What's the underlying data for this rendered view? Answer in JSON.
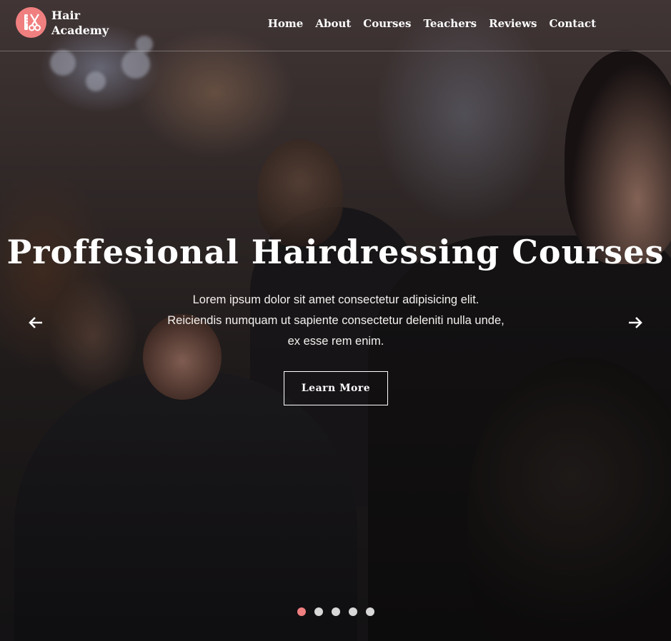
{
  "brand": {
    "line1": "Hair",
    "line2": "Academy",
    "icon": "scissors-comb-icon",
    "accent": "#f07f80"
  },
  "nav": {
    "items": [
      "Home",
      "About",
      "Courses",
      "Teachers",
      "Reviews",
      "Contact"
    ]
  },
  "hero": {
    "title": "Proffesional Hairdressing Courses",
    "lead_lines": [
      "Lorem ipsum dolor sit amet consectetur adipisicing elit.",
      "Reiciendis numquam ut sapiente consectetur deleniti nulla unde,",
      "ex esse rem enim."
    ],
    "cta_label": "Learn More",
    "prev_icon": "arrow-left-icon",
    "next_icon": "arrow-right-icon"
  },
  "slider": {
    "count": 5,
    "active_index": 0,
    "active_color": "#f07f80",
    "inactive_color": "#d8d8d8"
  }
}
